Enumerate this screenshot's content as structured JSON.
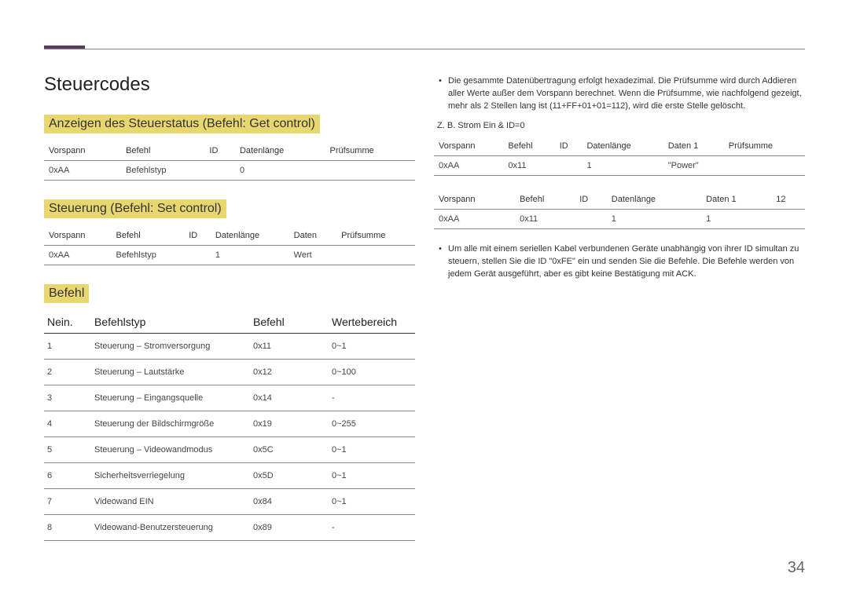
{
  "page_number": "34",
  "left": {
    "title": "Steuercodes",
    "get": {
      "heading": "Anzeigen des Steuerstatus (Befehl: Get control)",
      "headers": [
        "Vorspann",
        "Befehl",
        "ID",
        "Datenlänge",
        "Prüfsumme"
      ],
      "row": [
        "0xAA",
        "Befehlstyp",
        "",
        "0",
        ""
      ]
    },
    "set": {
      "heading": "Steuerung (Befehl: Set control)",
      "headers": [
        "Vorspann",
        "Befehl",
        "ID",
        "Datenlänge",
        "Daten",
        "Prüfsumme"
      ],
      "row": [
        "0xAA",
        "Befehlstyp",
        "",
        "1",
        "Wert",
        ""
      ]
    },
    "cmd": {
      "heading": "Befehl",
      "headers": [
        "Nein.",
        "Befehlstyp",
        "Befehl",
        "Wertebereich"
      ],
      "rows": [
        [
          "1",
          "Steuerung – Stromversorgung",
          "0x11",
          "0~1"
        ],
        [
          "2",
          "Steuerung – Lautstärke",
          "0x12",
          "0~100"
        ],
        [
          "3",
          "Steuerung – Eingangsquelle",
          "0x14",
          "-"
        ],
        [
          "4",
          "Steuerung der Bildschirmgröße",
          "0x19",
          "0~255"
        ],
        [
          "5",
          "Steuerung – Videowandmodus",
          "0x5C",
          "0~1"
        ],
        [
          "6",
          "Sicherheitsverriegelung",
          "0x5D",
          "0~1"
        ],
        [
          "7",
          "Videowand EIN",
          "0x84",
          "0~1"
        ],
        [
          "8",
          "Videowand-Benutzersteuerung",
          "0x89",
          "-"
        ]
      ]
    }
  },
  "right": {
    "bullet1": "Die gesammte Datenübertragung erfolgt hexadezimal. Die Prüfsumme wird durch Addieren aller Werte außer dem Vorspann berechnet. Wenn die Prüfsumme, wie nachfolgend gezeigt, mehr als 2 Stellen lang ist (11+FF+01+01=112), wird die erste Stelle gelöscht.",
    "note": "Z. B. Strom Ein & ID=0",
    "t1": {
      "headers": [
        "Vorspann",
        "Befehl",
        "ID",
        "Datenlänge",
        "Daten 1",
        "Prüfsumme"
      ],
      "row": [
        "0xAA",
        "0x11",
        "",
        "1",
        "\"Power\"",
        ""
      ]
    },
    "t2": {
      "headers": [
        "Vorspann",
        "Befehl",
        "ID",
        "Datenlänge",
        "Daten 1",
        "12"
      ],
      "row": [
        "0xAA",
        "0x11",
        "",
        "1",
        "1",
        ""
      ]
    },
    "bullet2": "Um alle mit einem seriellen Kabel verbundenen Geräte unabhängig von ihrer ID simultan zu steuern, stellen Sie die ID \"0xFE\" ein und senden Sie die Befehle. Die Befehle werden von jedem Gerät ausgeführt, aber es gibt keine Bestätigung mit ACK."
  }
}
